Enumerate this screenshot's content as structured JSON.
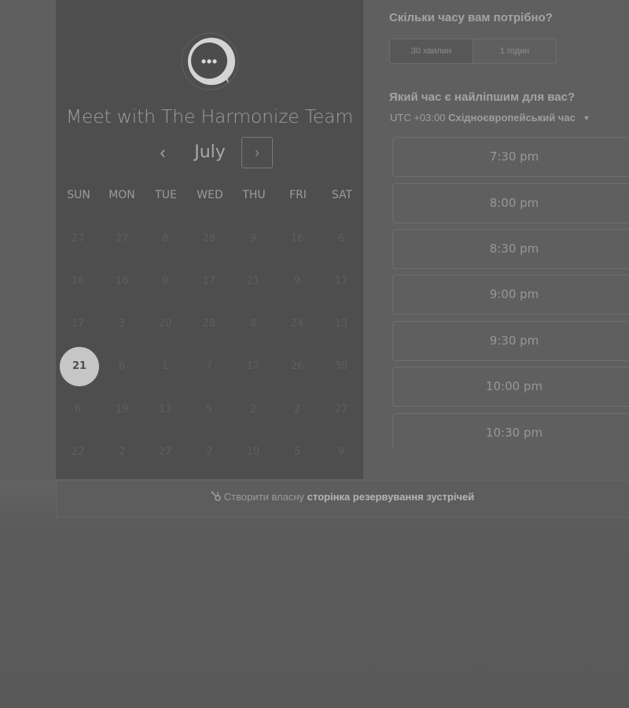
{
  "calendar": {
    "title": "Meet with The Harmonize Team",
    "month": "July",
    "prev_icon": "‹",
    "next_icon": "›",
    "weekdays": [
      "SUN",
      "MON",
      "TUE",
      "WED",
      "THU",
      "FRI",
      "SAT"
    ],
    "weeks": [
      [
        "27",
        "27",
        "8",
        "28",
        "9",
        "16",
        "6"
      ],
      [
        "16",
        "16",
        "9",
        "17",
        "21",
        "9",
        "17"
      ],
      [
        "17",
        "3",
        "20",
        "28",
        "8",
        "24",
        "13"
      ],
      [
        "21",
        "6",
        "1",
        "7",
        "17",
        "26",
        "30"
      ],
      [
        "6",
        "19",
        "13",
        "5",
        "2",
        "2",
        "27"
      ],
      [
        "22",
        "2",
        "27",
        "2",
        "10",
        "5",
        "9"
      ]
    ],
    "selected_day": "21"
  },
  "duration": {
    "question": "Скільки часу вам потрібно?",
    "options": [
      "30 хвилин",
      "1 годин"
    ],
    "selected": "30 хвилин"
  },
  "time": {
    "question": "Який час є найліпшим для вас?",
    "timezone_offset": "UTC +03:00",
    "timezone_name": "Східноєвропейський час",
    "slots": [
      "7:30 pm",
      "8:00 pm",
      "8:30 pm",
      "9:00 pm",
      "9:30 pm",
      "10:00 pm",
      "10:30 pm"
    ]
  },
  "footer": {
    "prefix": "Створити власну",
    "link": "сторінка резервування зустрічей"
  },
  "colors": {
    "panel": "#4e4e4e",
    "selected_day": "#c6c6c6",
    "text": "#a4a4a4"
  },
  "icons": [
    "chat-bubble-logo-icon",
    "chevron-left-icon",
    "chevron-right-icon",
    "caret-down-icon",
    "hubspot-sprocket-icon"
  ]
}
